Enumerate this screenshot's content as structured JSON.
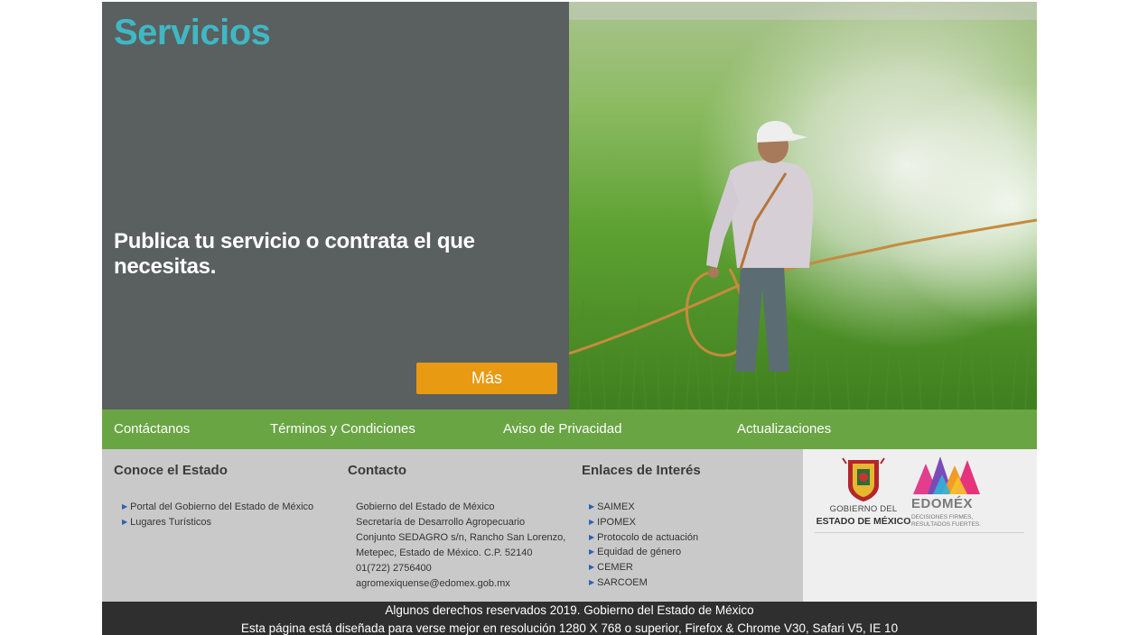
{
  "hero": {
    "title": "Servicios",
    "text": "Publica tu servicio o contrata el que necesitas.",
    "button_label": "Más",
    "image_alt": "farmer spraying crops in a rice field"
  },
  "nav": {
    "items": [
      {
        "label": "Contáctanos"
      },
      {
        "label": "Términos y Condiciones"
      },
      {
        "label": "Aviso de Privacidad"
      },
      {
        "label": "Actualizaciones"
      }
    ]
  },
  "footer": {
    "conoce": {
      "title": "Conoce el Estado",
      "links": [
        "Portal del Gobierno del Estado de México",
        "Lugares Turísticos"
      ]
    },
    "contacto": {
      "title": "Contacto",
      "lines": [
        "Gobierno del Estado de México",
        "Secretaría de Desarrollo Agropecuario",
        "Conjunto SEDAGRO s/n, Rancho San Lorenzo,",
        "Metepec, Estado de México. C.P. 52140",
        "01(722) 2756400",
        "agromexiquense@edomex.gob.mx"
      ]
    },
    "enlaces": {
      "title": "Enlaces de Interés",
      "links": [
        "SAIMEX",
        "IPOMEX",
        "Protocolo de actuación",
        "Equidad de género",
        "CEMER",
        "SARCOEM"
      ]
    },
    "logos": {
      "gobierno_line1": "GOBIERNO DEL",
      "gobierno_line2": "ESTADO DE MÉXICO",
      "edomex_name": "EDOMÉX",
      "edomex_tagline1": "DECISIONES FIRMES,",
      "edomex_tagline2": "RESULTADOS FUERTES."
    }
  },
  "bottom": {
    "line1": "Algunos derechos reservados 2019. Gobierno del Estado de México",
    "line2": "Esta página está diseñada para verse mejor en resolución 1280 X 768 o superior, Firefox & Chrome V30, Safari V5, IE 10"
  },
  "colors": {
    "accent_title": "#3fb8c4",
    "button": "#e89a12",
    "nav_green": "#6aa544",
    "panel_gray": "#5a5f5f"
  }
}
